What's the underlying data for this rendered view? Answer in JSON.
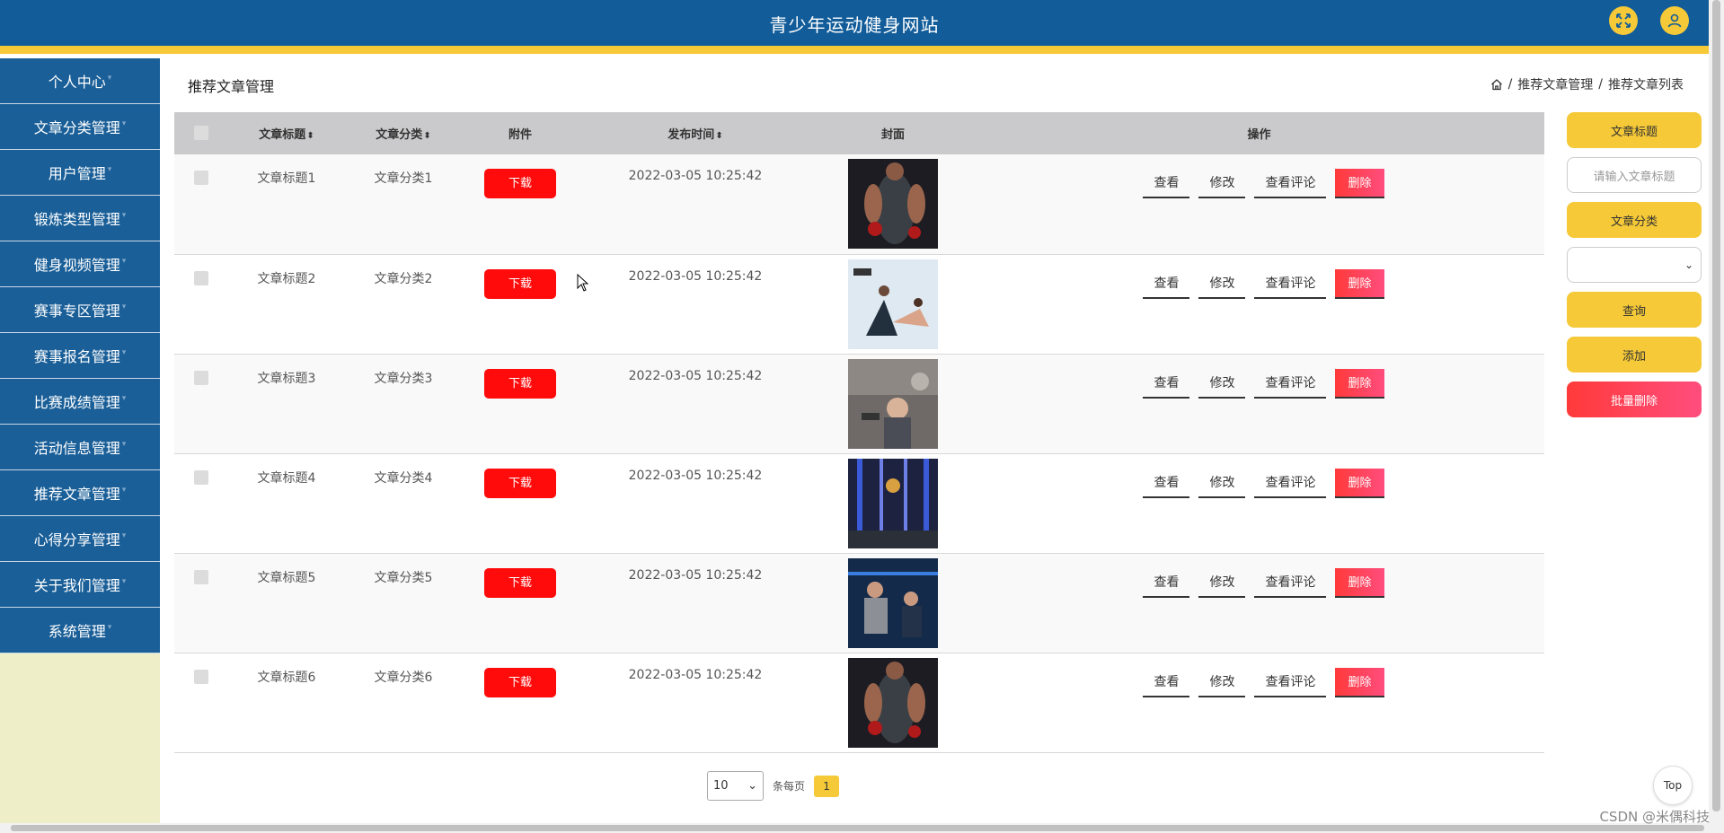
{
  "header": {
    "title": "青少年运动健身网站"
  },
  "sidebar": {
    "items": [
      {
        "label": "个人中心"
      },
      {
        "label": "文章分类管理"
      },
      {
        "label": "用户管理"
      },
      {
        "label": "锻炼类型管理"
      },
      {
        "label": "健身视频管理"
      },
      {
        "label": "赛事专区管理"
      },
      {
        "label": "赛事报名管理"
      },
      {
        "label": "比赛成绩管理"
      },
      {
        "label": "活动信息管理"
      },
      {
        "label": "推荐文章管理"
      },
      {
        "label": "心得分享管理"
      },
      {
        "label": "关于我们管理"
      },
      {
        "label": "系统管理"
      }
    ]
  },
  "page": {
    "title": "推荐文章管理",
    "breadcrumb": [
      "推荐文章管理",
      "推荐文章列表"
    ]
  },
  "table": {
    "headers": {
      "title": "文章标题",
      "category": "文章分类",
      "attachment": "附件",
      "publish_time": "发布时间",
      "cover": "封面",
      "actions": "操作"
    },
    "download_label": "下载",
    "actions": {
      "view": "查看",
      "edit": "修改",
      "view_comments": "查看评论",
      "delete": "删除"
    },
    "rows": [
      {
        "title": "文章标题1",
        "category": "文章分类1",
        "time": "2022-03-05 10:25:42"
      },
      {
        "title": "文章标题2",
        "category": "文章分类2",
        "time": "2022-03-05 10:25:42"
      },
      {
        "title": "文章标题3",
        "category": "文章分类3",
        "time": "2022-03-05 10:25:42"
      },
      {
        "title": "文章标题4",
        "category": "文章分类4",
        "time": "2022-03-05 10:25:42"
      },
      {
        "title": "文章标题5",
        "category": "文章分类5",
        "time": "2022-03-05 10:25:42"
      },
      {
        "title": "文章标题6",
        "category": "文章分类6",
        "time": "2022-03-05 10:25:42"
      }
    ]
  },
  "search_panel": {
    "title_label": "文章标题",
    "title_placeholder": "请输入文章标题",
    "category_label": "文章分类",
    "query_button": "查询",
    "add_button": "添加",
    "batch_delete_button": "批量删除"
  },
  "pagination": {
    "page_size": "10",
    "per_page_label": "条每页",
    "current_page": "1"
  },
  "top_button": "Top",
  "watermark": "CSDN @米偶科技",
  "colors": {
    "header": "#125c99",
    "accent": "#f5c937",
    "danger": "#ff0b0b",
    "sidebar_bg": "#eeeec9"
  }
}
